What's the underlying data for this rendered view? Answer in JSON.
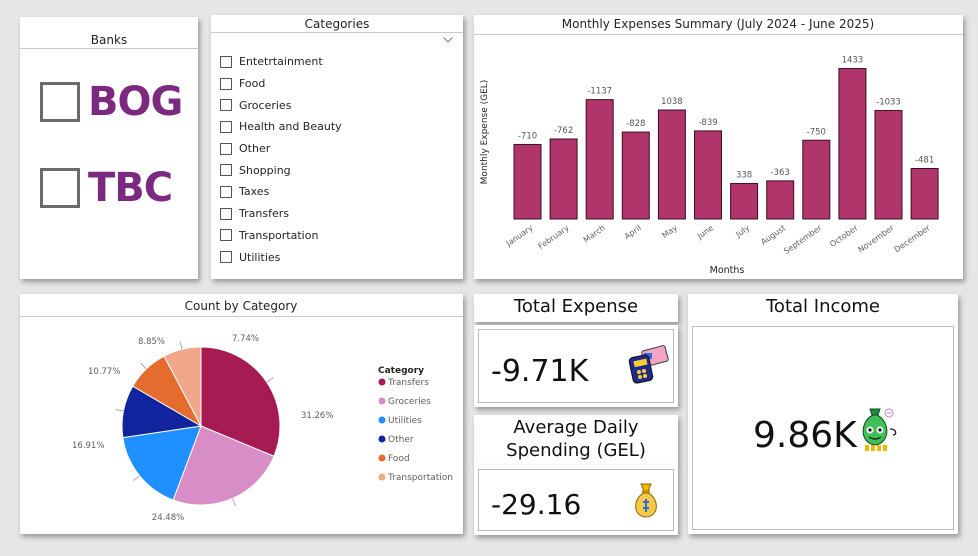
{
  "banks": {
    "title": "Banks",
    "items": [
      {
        "label": "BOG",
        "checked": false
      },
      {
        "label": "TBC",
        "checked": false
      }
    ]
  },
  "categories": {
    "title": "Categories",
    "items": [
      "Entetrtainment",
      "Food",
      "Groceries",
      "Health and Beauty",
      "Other",
      "Shopping",
      "Taxes",
      "Transfers",
      "Transportation",
      "Utilities"
    ]
  },
  "colors": {
    "bar": "#b0356a",
    "pie": [
      "#a51b52",
      "#d98dc6",
      "#1e90ff",
      "#12239e",
      "#e46c2e",
      "#f0a78a"
    ]
  },
  "chart_data": [
    {
      "type": "bar",
      "title": "Monthly Expenses Summary (July 2024 - June 2025)",
      "xlabel": "Months",
      "ylabel": "Monthly Expense (GEL)",
      "categories": [
        "January",
        "February",
        "March",
        "April",
        "May",
        "June",
        "July",
        "August",
        "September",
        "October",
        "November",
        "December"
      ],
      "values": [
        710,
        762,
        1137,
        828,
        1038,
        839,
        338,
        363,
        750,
        1433,
        1033,
        481
      ],
      "data_labels": [
        "-710",
        "-762",
        "-1137",
        "-828",
        "1038",
        "-839",
        "338",
        "-363",
        "-750",
        "1433",
        "-1033",
        "-481"
      ],
      "ylim": [
        0,
        1600
      ],
      "grid": false
    },
    {
      "type": "pie",
      "title": "Count by Category",
      "legend_title": "Category",
      "legend_position": "right",
      "labels": [
        "Transfers",
        "Groceries",
        "Utilities",
        "Other",
        "Food",
        "Transportation"
      ],
      "values": [
        31.26,
        24.48,
        16.91,
        10.77,
        8.85,
        7.74
      ],
      "data_labels": [
        "31.26%",
        "24.48%",
        "16.91%",
        "10.77%",
        "8.85%",
        "7.74%"
      ]
    }
  ],
  "cards": {
    "total_expense": {
      "title": "Total Expense",
      "value": "-9.71K",
      "icon": "credit-card-icon"
    },
    "avg_daily": {
      "title_line1": "Average Daily",
      "title_line2": "Spending (GEL)",
      "value": "-29.16",
      "icon": "money-bag-icon"
    },
    "total_income": {
      "title": "Total Income",
      "value": "9.86K",
      "icon": "money-bag-character-icon"
    }
  }
}
